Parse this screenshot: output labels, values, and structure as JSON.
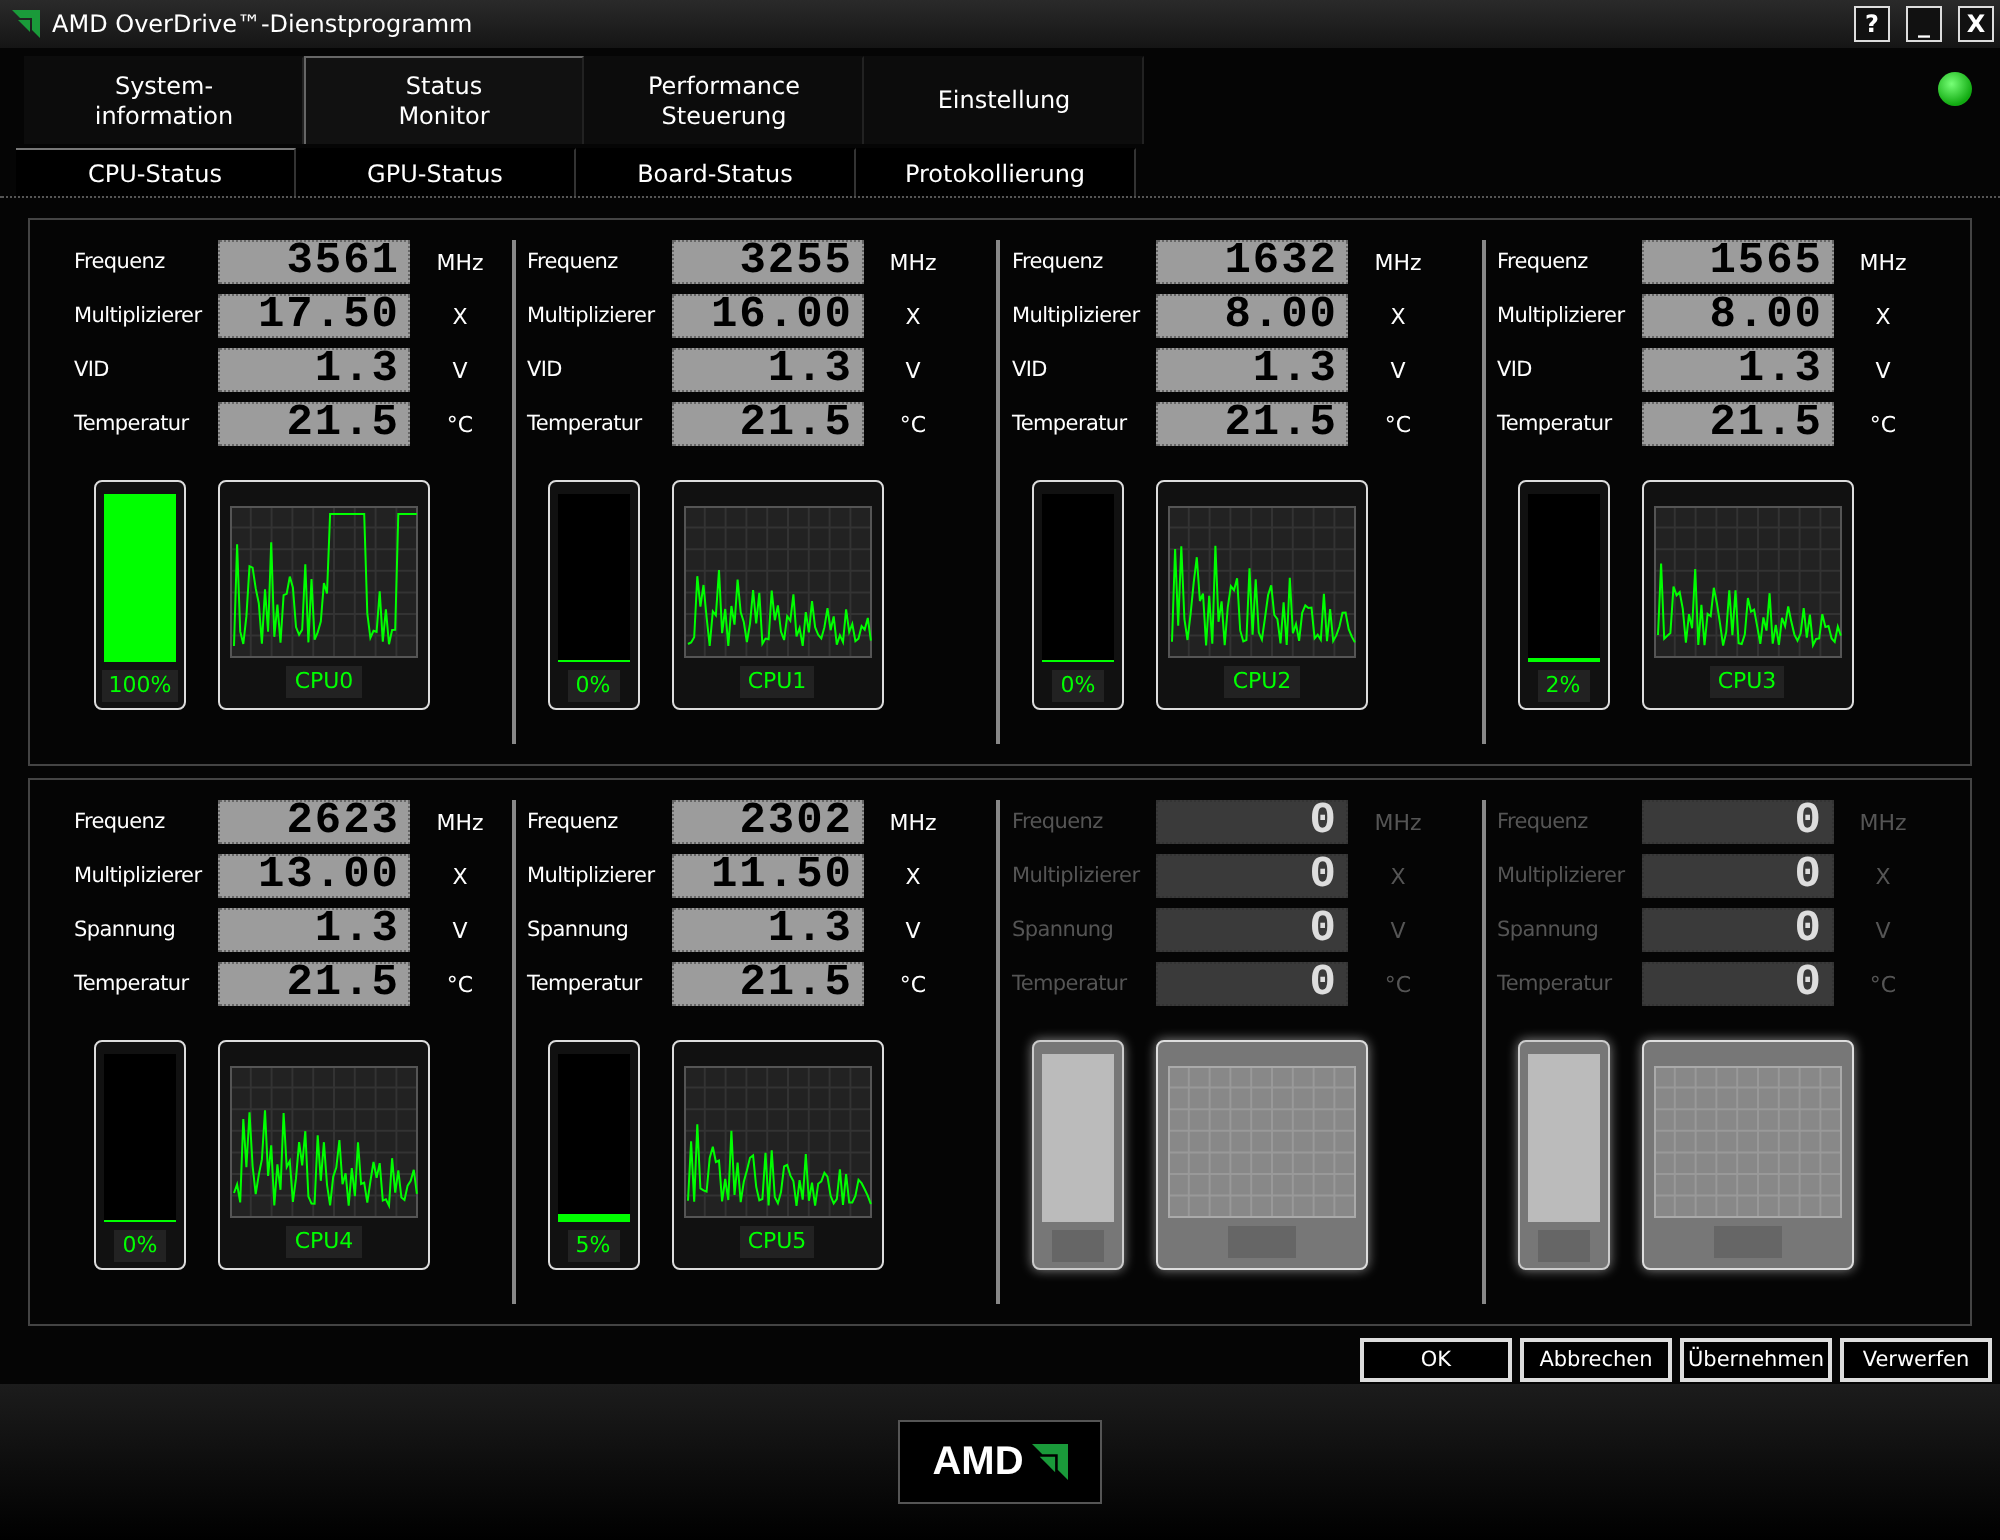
{
  "window": {
    "title": "AMD OverDrive™-Dienstprogramm",
    "controls": [
      "?",
      "_",
      "X"
    ]
  },
  "tabs": [
    {
      "label": "System-\ninformation",
      "selected": false
    },
    {
      "label": "Status\nMonitor",
      "selected": true
    },
    {
      "label": "Performance\nSteuerung",
      "selected": false
    },
    {
      "label": "Einstellung",
      "selected": false
    }
  ],
  "subtabs": [
    {
      "label": "CPU-Status",
      "selected": true
    },
    {
      "label": "GPU-Status",
      "selected": false
    },
    {
      "label": "Board-Status",
      "selected": false
    },
    {
      "label": "Protokollierung",
      "selected": false
    }
  ],
  "core_groups": [
    {
      "cores": [
        {
          "disabled": false,
          "rows": [
            {
              "label": "Frequenz",
              "value": "3561",
              "unit": "MHz"
            },
            {
              "label": "Multiplizierer",
              "value": "17.50",
              "unit": "X"
            },
            {
              "label": "VID",
              "value": "1.3",
              "unit": "V"
            },
            {
              "label": "Temperatur",
              "value": "21.5",
              "unit": "°C"
            }
          ],
          "meter": {
            "level": 1,
            "reading": "100%"
          },
          "graph_label": "CPU0"
        },
        {
          "disabled": false,
          "rows": [
            {
              "label": "Frequenz",
              "value": "3255",
              "unit": "MHz"
            },
            {
              "label": "Multiplizierer",
              "value": "16.00",
              "unit": "X"
            },
            {
              "label": "VID",
              "value": "1.3",
              "unit": "V"
            },
            {
              "label": "Temperatur",
              "value": "21.5",
              "unit": "°C"
            }
          ],
          "meter": {
            "level": 0,
            "reading": "0%"
          },
          "graph_label": "CPU1"
        },
        {
          "disabled": false,
          "rows": [
            {
              "label": "Frequenz",
              "value": "1632",
              "unit": "MHz"
            },
            {
              "label": "Multiplizierer",
              "value": "8.00",
              "unit": "X"
            },
            {
              "label": "VID",
              "value": "1.3",
              "unit": "V"
            },
            {
              "label": "Temperatur",
              "value": "21.5",
              "unit": "°C"
            }
          ],
          "meter": {
            "level": 0,
            "reading": "0%"
          },
          "graph_label": "CPU2"
        },
        {
          "disabled": false,
          "rows": [
            {
              "label": "Frequenz",
              "value": "1565",
              "unit": "MHz"
            },
            {
              "label": "Multiplizierer",
              "value": "8.00",
              "unit": "X"
            },
            {
              "label": "VID",
              "value": "1.3",
              "unit": "V"
            },
            {
              "label": "Temperatur",
              "value": "21.5",
              "unit": "°C"
            }
          ],
          "meter": {
            "level": 0.02,
            "reading": "2%"
          },
          "graph_label": "CPU3"
        }
      ]
    },
    {
      "cores": [
        {
          "disabled": false,
          "rows": [
            {
              "label": "Frequenz",
              "value": "2623",
              "unit": "MHz"
            },
            {
              "label": "Multiplizierer",
              "value": "13.00",
              "unit": "X"
            },
            {
              "label": "Spannung",
              "value": "1.3",
              "unit": "V"
            },
            {
              "label": "Temperatur",
              "value": "21.5",
              "unit": "°C"
            }
          ],
          "meter": {
            "level": 0,
            "reading": "0%"
          },
          "graph_label": "CPU4"
        },
        {
          "disabled": false,
          "rows": [
            {
              "label": "Frequenz",
              "value": "2302",
              "unit": "MHz"
            },
            {
              "label": "Multiplizierer",
              "value": "11.50",
              "unit": "X"
            },
            {
              "label": "Spannung",
              "value": "1.3",
              "unit": "V"
            },
            {
              "label": "Temperatur",
              "value": "21.5",
              "unit": "°C"
            }
          ],
          "meter": {
            "level": 0.05,
            "reading": "5%"
          },
          "graph_label": "CPU5"
        },
        {
          "disabled": true,
          "rows": [
            {
              "label": "Frequenz",
              "value": "0",
              "unit": "MHz"
            },
            {
              "label": "Multiplizierer",
              "value": "0",
              "unit": "X"
            },
            {
              "label": "Spannung",
              "value": "0",
              "unit": "V"
            },
            {
              "label": "Temperatur",
              "value": "0",
              "unit": "°C"
            }
          ]
        },
        {
          "disabled": true,
          "rows": [
            {
              "label": "Frequenz",
              "value": "0",
              "unit": "MHz"
            },
            {
              "label": "Multiplizierer",
              "value": "0",
              "unit": "X"
            },
            {
              "label": "Spannung",
              "value": "0",
              "unit": "V"
            },
            {
              "label": "Temperatur",
              "value": "0",
              "unit": "°C"
            }
          ]
        }
      ]
    }
  ],
  "buttons": [
    "OK",
    "Abbrechen",
    "Übernehmen",
    "Verwerfen"
  ],
  "footer": {
    "logo_text": "AMD"
  }
}
